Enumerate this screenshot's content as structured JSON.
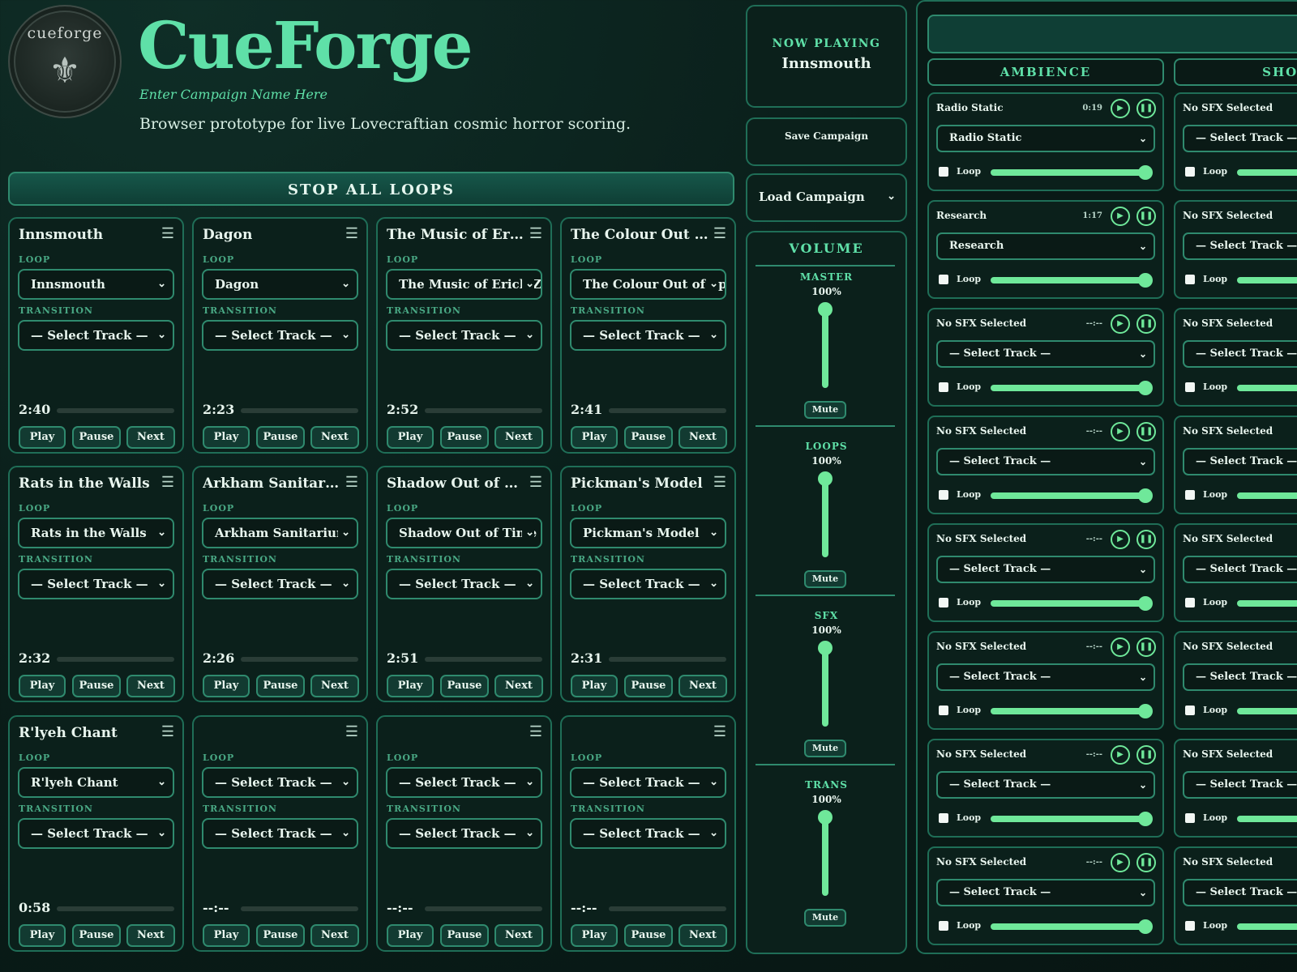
{
  "header": {
    "logo_text": "cueforge",
    "title": "CueForge",
    "campaign_placeholder": "Enter Campaign Name Here",
    "tagline": "Browser prototype for live Lovecraftian cosmic horror scoring."
  },
  "stop_all_label": "STOP ALL LOOPS",
  "labels": {
    "loop": "LOOP",
    "transition": "TRANSITION",
    "play": "Play",
    "pause": "Pause",
    "next": "Next",
    "select_track": "— Select Track —"
  },
  "cards": [
    {
      "title": "Innsmouth",
      "loop": "Innsmouth",
      "transition": "— Select Track —",
      "time": "2:40"
    },
    {
      "title": "Dagon",
      "loop": "Dagon",
      "transition": "— Select Track —",
      "time": "2:23"
    },
    {
      "title": "The Music of Eric...",
      "loop": "The Music of Erich Z",
      "transition": "— Select Track —",
      "time": "2:52"
    },
    {
      "title": "The Colour Out o...",
      "loop": "The Colour Out of Sp",
      "transition": "— Select Track —",
      "time": "2:41"
    },
    {
      "title": "Rats in the Walls",
      "loop": "Rats in the Walls",
      "transition": "— Select Track —",
      "time": "2:32"
    },
    {
      "title": "Arkham Sanitari...",
      "loop": "Arkham Sanitarium",
      "transition": "— Select Track —",
      "time": "2:26"
    },
    {
      "title": "Shadow Out of Ti...",
      "loop": "Shadow Out of Time",
      "transition": "— Select Track —",
      "time": "2:51"
    },
    {
      "title": "Pickman's Model",
      "loop": "Pickman's Model",
      "transition": "— Select Track —",
      "time": "2:31"
    },
    {
      "title": "R'lyeh Chant",
      "loop": "R'lyeh Chant",
      "transition": "— Select Track —",
      "time": "0:58"
    },
    {
      "title": "",
      "loop": "— Select Track —",
      "transition": "— Select Track —",
      "time": "--:--"
    },
    {
      "title": "",
      "loop": "— Select Track —",
      "transition": "— Select Track —",
      "time": "--:--"
    },
    {
      "title": "",
      "loop": "— Select Track —",
      "transition": "— Select Track —",
      "time": "--:--"
    }
  ],
  "now_playing": {
    "label": "NOW PLAYING",
    "track": "Innsmouth"
  },
  "save_campaign": "Save Campaign",
  "load_campaign": "Load Campaign",
  "volume": {
    "title": "VOLUME",
    "mute_label": "Mute",
    "faders": [
      {
        "name": "MASTER",
        "value": "100%"
      },
      {
        "name": "LOOPS",
        "value": "100%"
      },
      {
        "name": "SFX",
        "value": "100%"
      },
      {
        "name": "TRANS",
        "value": "100%"
      }
    ]
  },
  "sfx_columns": [
    {
      "name": "AMBIENCE",
      "slots": [
        {
          "title": "Radio Static",
          "time": "0:19",
          "track": "Radio Static",
          "loop_label": "Loop"
        },
        {
          "title": "Research",
          "time": "1:17",
          "track": "Research",
          "loop_label": "Loop"
        },
        {
          "title": "No SFX Selected",
          "time": "--:--",
          "track": "— Select Track —",
          "loop_label": "Loop"
        },
        {
          "title": "No SFX Selected",
          "time": "--:--",
          "track": "— Select Track —",
          "loop_label": "Loop"
        },
        {
          "title": "No SFX Selected",
          "time": "--:--",
          "track": "— Select Track —",
          "loop_label": "Loop"
        },
        {
          "title": "No SFX Selected",
          "time": "--:--",
          "track": "— Select Track —",
          "loop_label": "Loop"
        },
        {
          "title": "No SFX Selected",
          "time": "--:--",
          "track": "— Select Track —",
          "loop_label": "Loop"
        },
        {
          "title": "No SFX Selected",
          "time": "--:--",
          "track": "— Select Track —",
          "loop_label": "Loop"
        }
      ]
    },
    {
      "name": "SHOGG",
      "slots": [
        {
          "title": "No SFX Selected",
          "track": "— Select Track —",
          "loop_label": "Loop"
        },
        {
          "title": "No SFX Selected",
          "track": "— Select Track —",
          "loop_label": "Loop"
        },
        {
          "title": "No SFX Selected",
          "track": "— Select Track —",
          "loop_label": "Loop"
        },
        {
          "title": "No SFX Selected",
          "track": "— Select Track —",
          "loop_label": "Loop"
        },
        {
          "title": "No SFX Selected",
          "track": "— Select Track —",
          "loop_label": "Loop"
        },
        {
          "title": "No SFX Selected",
          "track": "— Select Track —",
          "loop_label": "Loop"
        },
        {
          "title": "No SFX Selected",
          "track": "— Select Track —",
          "loop_label": "Loop"
        },
        {
          "title": "No SFX Selected",
          "track": "— Select Track —",
          "loop_label": "Loop"
        }
      ]
    }
  ],
  "icons": {
    "play": "play-icon",
    "pause": "pause-icon",
    "menu": "hamburger-menu-icon",
    "chevron": "chevron-down-icon"
  },
  "colors": {
    "accent": "#5fe0a8",
    "slider": "#6fe89a",
    "background": "#0a1e1a",
    "border": "#1f6e57"
  }
}
